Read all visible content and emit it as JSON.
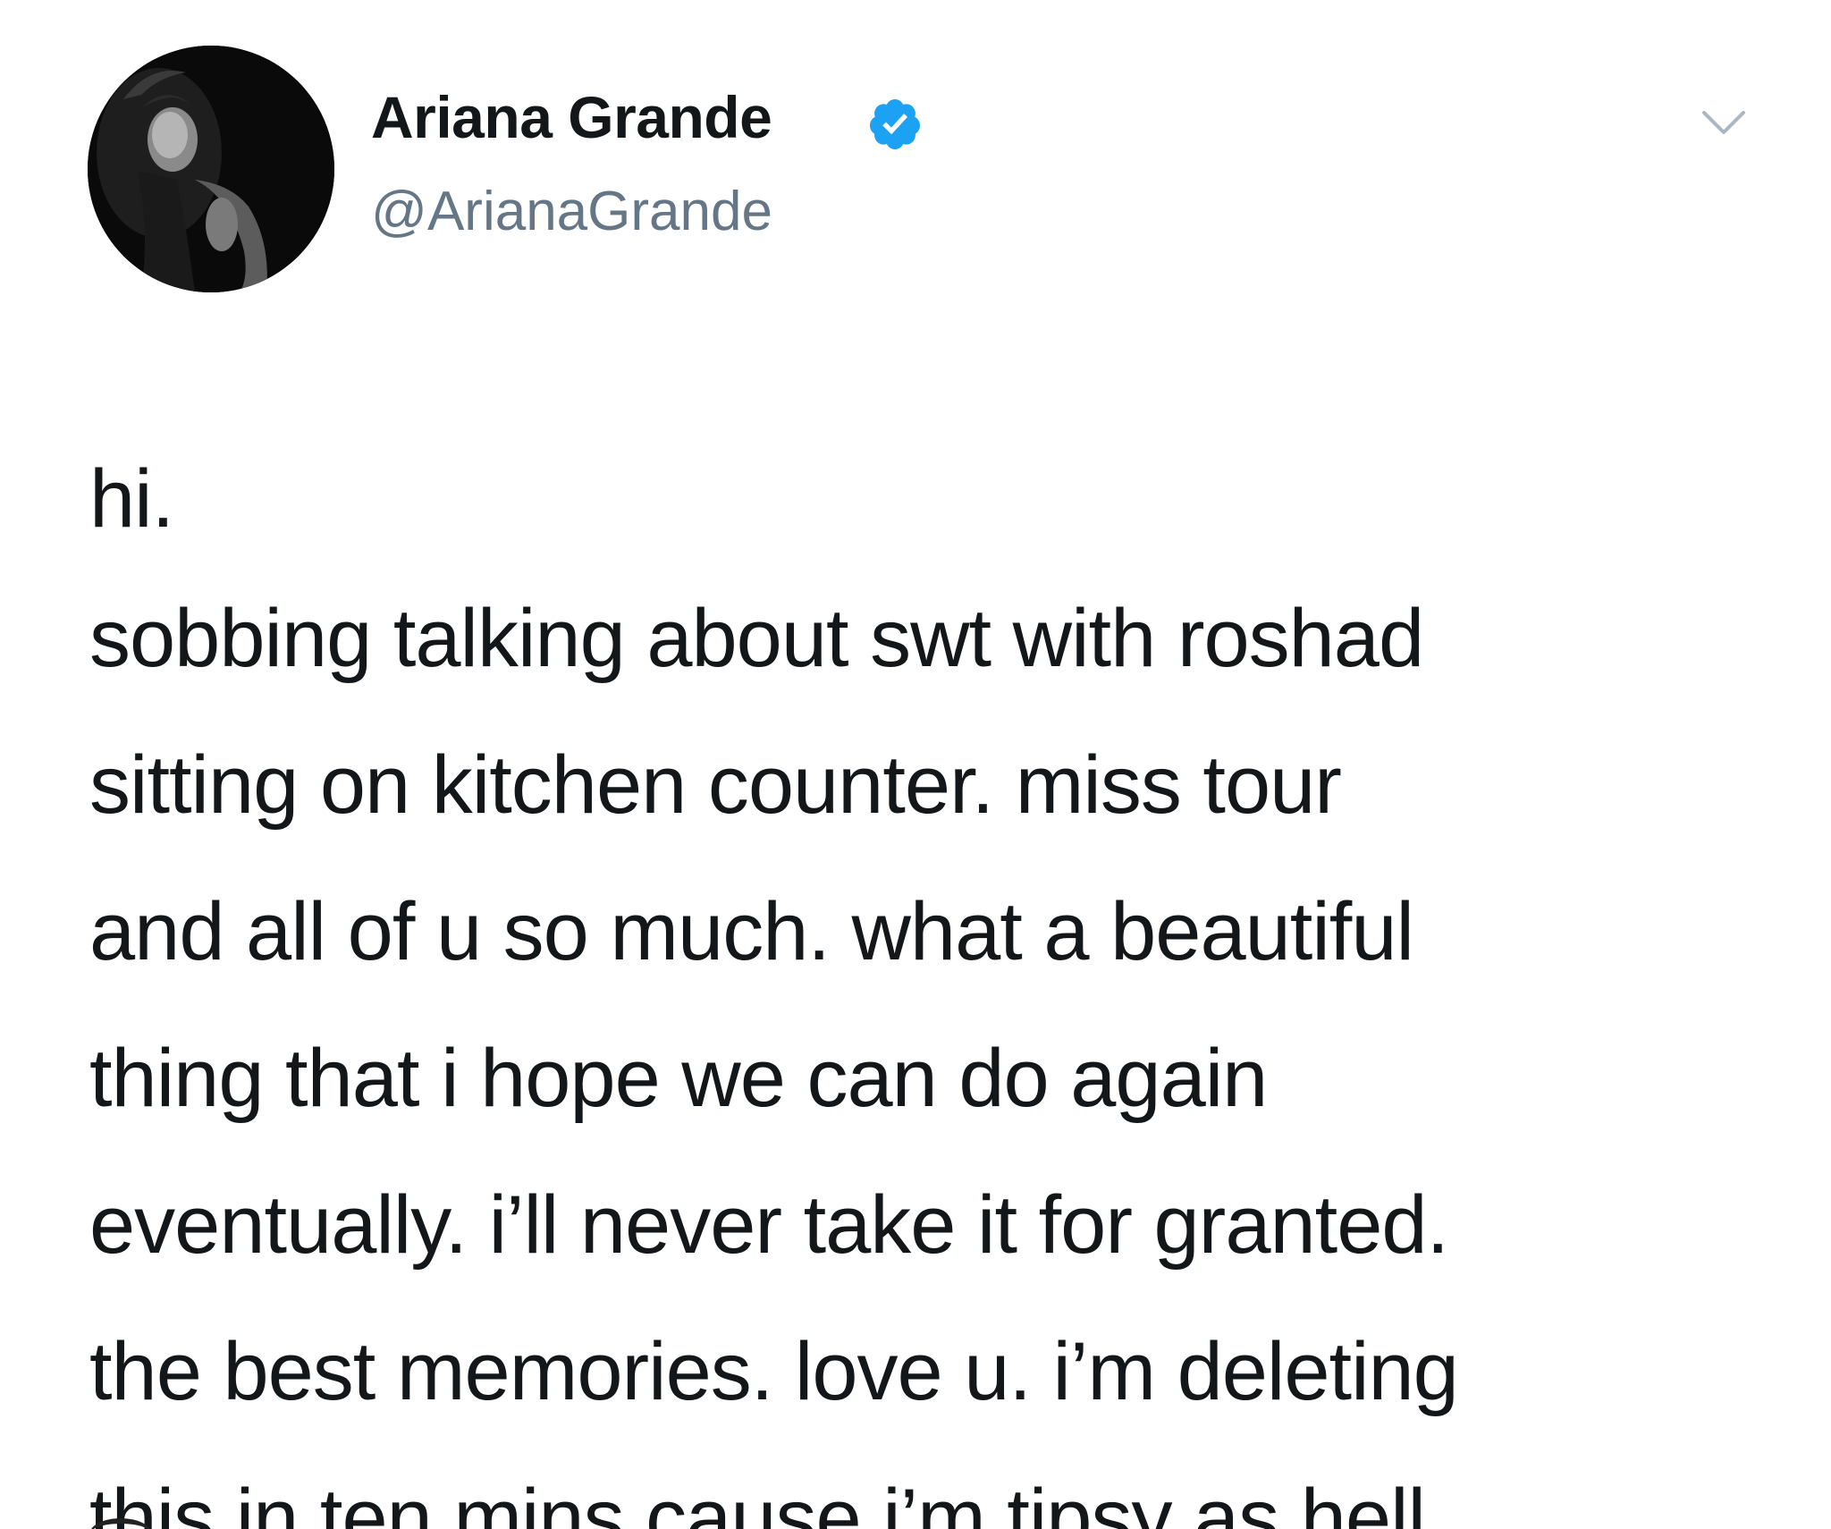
{
  "tweet": {
    "author": {
      "display_name": "Ariana Grande",
      "handle": "@ArianaGrande",
      "verified": true
    },
    "text_lines": [
      "hi.",
      "sobbing talking about swt with roshad",
      "sitting on kitchen counter. miss tour",
      "and all of u so much. what a beautiful",
      "thing that i hope we can do again",
      "eventually. i’ll never take it for granted.",
      "the best memories. love u. i’m deleting",
      "this in ten mins cause i’m tipsy as hell."
    ],
    "icons": {
      "verified": "verified-badge-icon",
      "menu": "chevron-down-icon"
    },
    "colors": {
      "verified_badge": "#1da1f2",
      "handle_gray": "#657786",
      "caret_gray": "#aab8c2",
      "text": "#14171a"
    }
  }
}
